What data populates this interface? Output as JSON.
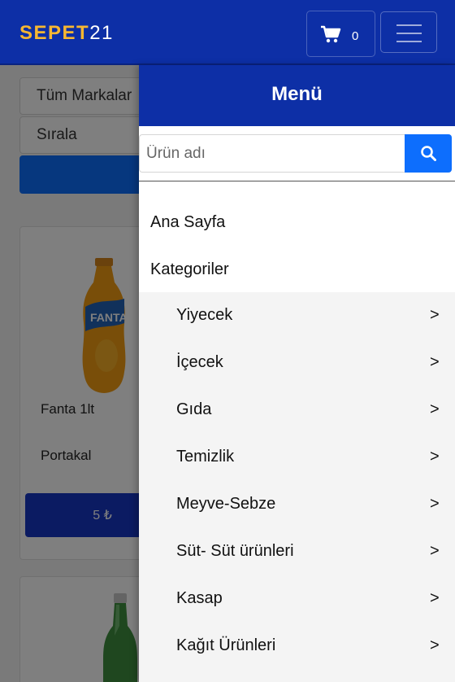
{
  "brand": {
    "part1": "SEPET",
    "part2": "21"
  },
  "header": {
    "cart_count": "0"
  },
  "filters": {
    "brand_select": "Tüm Markalar",
    "sort_select": "Sırala"
  },
  "products": [
    {
      "name": "Fanta 1lt",
      "variant": "Portakal",
      "price": "5 ₺"
    }
  ],
  "menu": {
    "title": "Menü",
    "search_placeholder": "Ürün adı",
    "links": [
      "Ana Sayfa",
      "Kategoriler"
    ],
    "categories": [
      {
        "label": "Yiyecek",
        "arrow": ">"
      },
      {
        "label": "İçecek",
        "arrow": ">"
      },
      {
        "label": "Gıda",
        "arrow": ">"
      },
      {
        "label": "Temizlik",
        "arrow": ">"
      },
      {
        "label": "Meyve-Sebze",
        "arrow": ">"
      },
      {
        "label": "Süt- Süt ürünleri",
        "arrow": ">"
      },
      {
        "label": "Kasap",
        "arrow": ">"
      },
      {
        "label": "Kağıt Ürünleri",
        "arrow": ">"
      }
    ]
  },
  "icons": {
    "cart": "shopping-cart-icon",
    "search": "search-icon",
    "menu": "hamburger-icon"
  },
  "colors": {
    "navbar": "#0d2fa6",
    "brand_accent": "#f7b731",
    "primary": "#0d6efd",
    "price_button": "#1736c4"
  }
}
